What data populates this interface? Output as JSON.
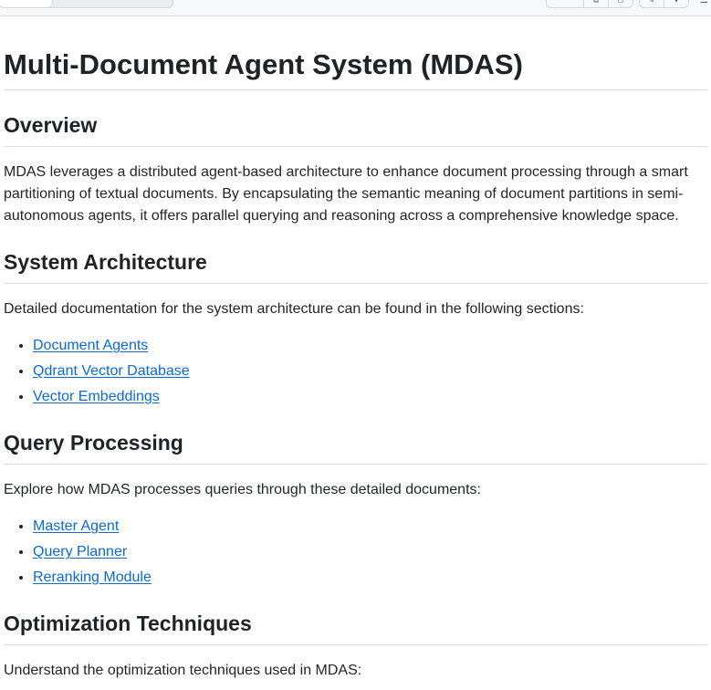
{
  "document": {
    "title": "Multi-Document Agent System (MDAS)",
    "sections": [
      {
        "heading": "Overview",
        "text": "MDAS leverages a distributed agent-based architecture to enhance document processing through a smart partitioning of textual documents. By encapsulating the semantic meaning of document partitions in semi-autonomous agents, it offers parallel querying and reasoning across a comprehensive knowledge space."
      },
      {
        "heading": "System Architecture",
        "text": "Detailed documentation for the system architecture can be found in the following sections:",
        "links": [
          "Document Agents",
          "Qdrant Vector Database",
          "Vector Embeddings"
        ]
      },
      {
        "heading": "Query Processing",
        "text": "Explore how MDAS processes queries through these detailed documents:",
        "links": [
          "Master Agent",
          "Query Planner",
          "Reranking Module"
        ]
      },
      {
        "heading": "Optimization Techniques",
        "text": "Understand the optimization techniques used in MDAS:"
      }
    ]
  }
}
